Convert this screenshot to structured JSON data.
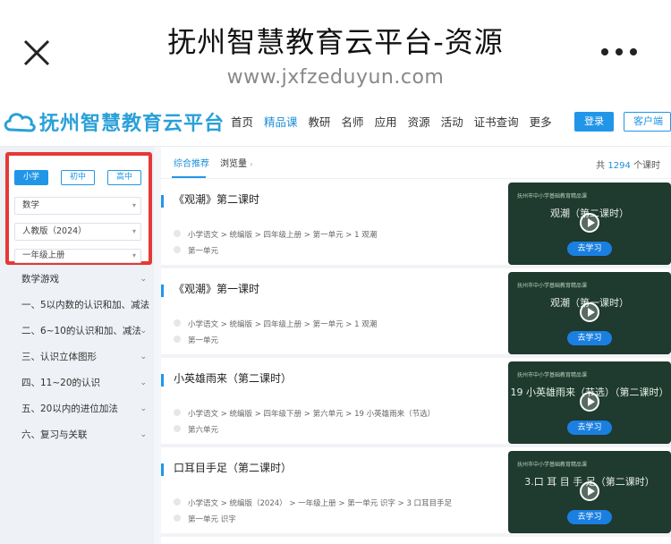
{
  "wechat": {
    "title": "抚州智慧教育云平台-资源",
    "url": "www.jxfzeduyun.com"
  },
  "site": {
    "logo_text": "抚州智慧教育云平台",
    "nav": [
      "首页",
      "精品课",
      "教研",
      "名师",
      "应用",
      "资源",
      "活动",
      "证书查询",
      "更多"
    ],
    "active_nav": "精品课",
    "login_label": "登录",
    "client_label": "客户端"
  },
  "filters": {
    "stages": [
      "小学",
      "初中",
      "高中"
    ],
    "active_stage": "小学",
    "subject": "数学",
    "edition": "人教版（2024）",
    "grade": "一年级上册"
  },
  "menu": [
    "数学游戏",
    "一、5以内数的认识和加、减法",
    "二、6~10的认识和加、减法",
    "三、认识立体图形",
    "四、11~20的认识",
    "五、20以内的进位加法",
    "六、复习与关联"
  ],
  "content": {
    "tabs": [
      "综合推荐",
      "浏览量"
    ],
    "total_prefix": "共 ",
    "total_count": "1294",
    "total_suffix": " 个课时",
    "cards": [
      {
        "title": "《观潮》第二课时",
        "path": "小学语文 > 统编版 > 四年级上册 > 第一单元 > 1 观潮",
        "unit": "第一单元",
        "thumb_header": "抚州市中小学基础教育精品课",
        "thumb_title": "观潮（第二课时）",
        "study": "去学习"
      },
      {
        "title": "《观潮》第一课时",
        "path": "小学语文 > 统编版 > 四年级上册 > 第一单元 > 1 观潮",
        "unit": "第一单元",
        "thumb_header": "抚州市中小学基础教育精品课",
        "thumb_title": "观潮（第一课时）",
        "study": "去学习"
      },
      {
        "title": "小英雄雨来（第二课时）",
        "path": "小学语文 > 统编版 > 四年级下册 > 第六单元 > 19 小英雄雨来（节选）",
        "unit": "第六单元",
        "thumb_header": "抚州市中小学基础教育精品课",
        "thumb_title": "19 小英雄雨来（节选）（第二课时）",
        "study": "去学习"
      },
      {
        "title": "口耳目手足（第二课时）",
        "path": "小学语文 > 统编版（2024） > 一年级上册 > 第一单元 识字 > 3 口耳目手足",
        "unit": "第一单元 识字",
        "thumb_header": "抚州市中小学基础教育精品课",
        "thumb_title": "3.口 耳 目 手 足（第二课时）",
        "study": "去学习"
      }
    ]
  }
}
